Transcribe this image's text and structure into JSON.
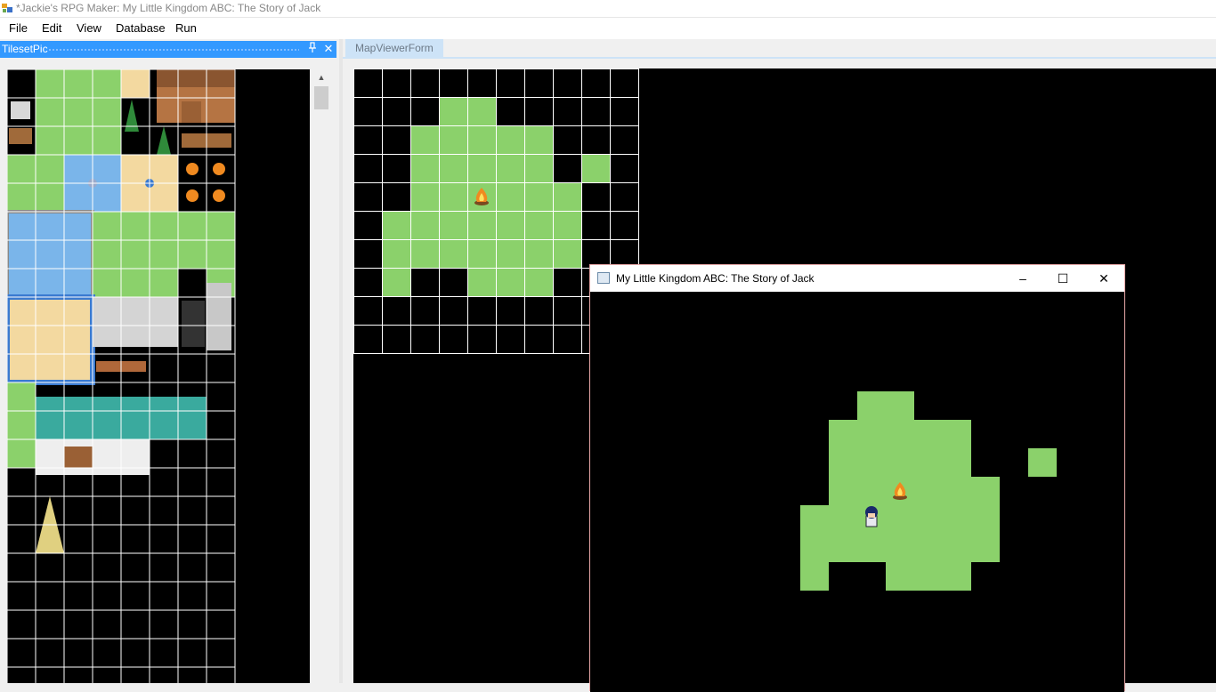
{
  "app": {
    "title": "*Jackie's RPG Maker: My Little Kingdom ABC: The Story of Jack"
  },
  "menu": {
    "items": [
      {
        "label": "File"
      },
      {
        "label": "Edit"
      },
      {
        "label": "View"
      },
      {
        "label": "Database"
      },
      {
        "label": "Run"
      }
    ]
  },
  "tileset_panel": {
    "title": "TilesetPic",
    "pin_icon": "pin-icon",
    "close_icon": "close-icon"
  },
  "doc_tab": {
    "label": "MapViewerForm"
  },
  "game_window": {
    "title": "My Little Kingdom ABC: The Story of Jack",
    "minimize_label": "–",
    "maximize_label": "☐",
    "close_label": "✕"
  },
  "map": {
    "cols": 10,
    "rows": 10,
    "grass_rows": [
      "..........",
      "...##.....",
      "..#####...",
      "..#####.#.",
      "..######..",
      ".#######..",
      ".#######..",
      ".#..###...",
      "..........",
      ".........."
    ],
    "campfire": {
      "row": 4,
      "col": 4
    }
  },
  "game_view": {
    "grass_rows": [
      "..##.....",
      ".#####...",
      ".#####...",
      ".######..",
      "#######..",
      "#######..",
      "#..###..."
    ],
    "extra_grass": {
      "row": 2,
      "col": 7
    },
    "campfire": {
      "row": 3,
      "col": 3
    },
    "player": {
      "row": 4,
      "col": 2
    }
  },
  "colors": {
    "grass": "#8bd16b",
    "water": "#7ab5ea",
    "sand": "#f3d9a0",
    "roof": "#3aaa9e",
    "panel_header": "#3399ff"
  }
}
